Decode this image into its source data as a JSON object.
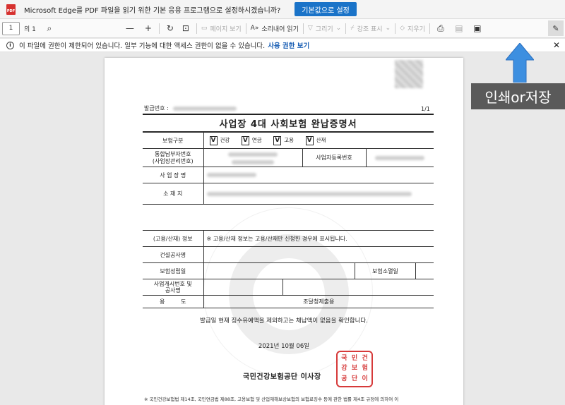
{
  "notification": {
    "badge": "PDF",
    "message": "Microsoft Edge를 PDF 파일을 읽기 위한 기본 응용 프로그램으로 설정하시겠습니까?",
    "button": "기본값으로 설정"
  },
  "toolbar": {
    "page_current": "1",
    "page_total": "의 1",
    "page_view": "페이지 보기",
    "read_aloud": "소리내어 읽기",
    "draw": "그리기",
    "highlight": "강조 표시",
    "erase": "지우기"
  },
  "infobar": {
    "icon": "i",
    "message": "이 파일에 권한이 제한되어 있습니다. 일부 기능에 대한 액세스 권한이 없을 수 있습니다.",
    "link": "사용 권한 보기",
    "close": "✕"
  },
  "document": {
    "issue_label": "발급번호 :",
    "page_count": "1/1",
    "title": "사업장 4대 사회보험 완납증명서",
    "rows": {
      "insurance_type": "보험구분",
      "check_mark": "V",
      "check_health": "건강",
      "check_pension": "연금",
      "check_employment": "고용",
      "check_industrial": "산재",
      "integrated_no": "통합납부자번호\n(사업장관리번호)",
      "business_reg_no": "사업자등록번호",
      "business_name": "사 업 장 명",
      "address": "소 재 지",
      "employment_info": "(고용/산재) 정보",
      "employment_note": "※ 고용/산재 정보는 고용/산재만 신청한 경우에 표시됩니다.",
      "construction_name": "건설공사명",
      "established": "보험성립일",
      "terminated": "보험소멸일",
      "start_no": "사업개시번호 및\n공사명",
      "usage": "용         도",
      "procurement": "조달청제출용"
    },
    "confirmation": "발급일 현재 징수유예액을 제외하고는 체납액이 없음을 확인합니다.",
    "date": "2021년 10월 06일",
    "issuer": "국민건강보험공단  이사장",
    "seal": [
      "국",
      "민",
      "건",
      "강",
      "보",
      "험",
      "공",
      "단",
      "이"
    ],
    "footnote": "※ 국민건강보험법 제14조, 국민연금법 제88조, 고용보험 및 산업재해보상보험의 보험료징수 등에 관한 법률 제4조 규정에 의하여 이"
  },
  "annotation": {
    "label": "인쇄or저장",
    "arrow_color": "#3d8fe0"
  }
}
